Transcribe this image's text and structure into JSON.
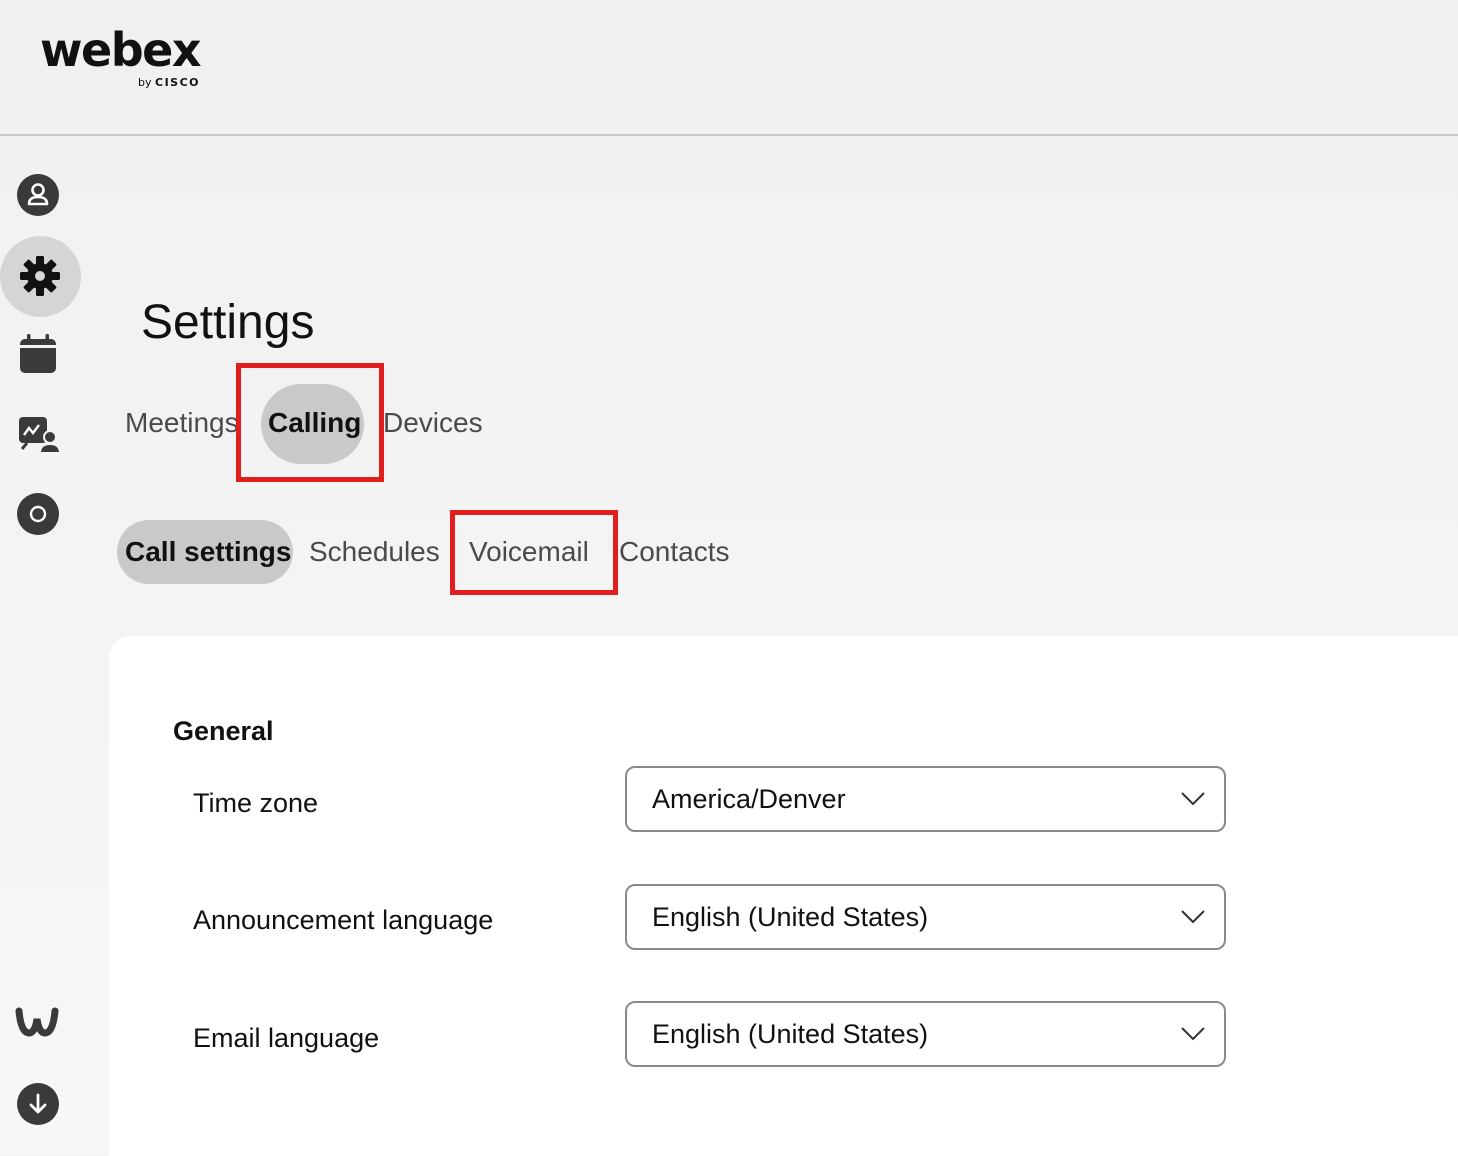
{
  "brand": {
    "name": "webex",
    "by": "by",
    "company": "CISCO"
  },
  "rail": {
    "items": [
      {
        "name": "profile",
        "icon": "user-icon"
      },
      {
        "name": "settings",
        "icon": "gear-icon",
        "active": true
      },
      {
        "name": "calendar",
        "icon": "calendar-icon"
      },
      {
        "name": "whiteboard-people",
        "icon": "whiteboard-person-icon"
      },
      {
        "name": "status",
        "icon": "circle-icon"
      }
    ],
    "bottom": [
      {
        "name": "webex-app",
        "icon": "webex-logo-icon"
      },
      {
        "name": "download",
        "icon": "download-icon"
      }
    ]
  },
  "page": {
    "title": "Settings"
  },
  "tabs": [
    {
      "label": "Meetings"
    },
    {
      "label": "Calling",
      "active": true
    },
    {
      "label": "Devices"
    }
  ],
  "subtabs": [
    {
      "label": "Call settings",
      "active": true
    },
    {
      "label": "Schedules"
    },
    {
      "label": "Voicemail"
    },
    {
      "label": "Contacts"
    }
  ],
  "general": {
    "title": "General",
    "rows": [
      {
        "label": "Time zone",
        "value": "America/Denver"
      },
      {
        "label": "Announcement language",
        "value": "English (United States)"
      },
      {
        "label": "Email language",
        "value": "English (United States)"
      }
    ]
  },
  "colors": {
    "highlight": "#e01e1e",
    "pill": "#c9c9c9",
    "active_rail": "#d5d5d5"
  }
}
